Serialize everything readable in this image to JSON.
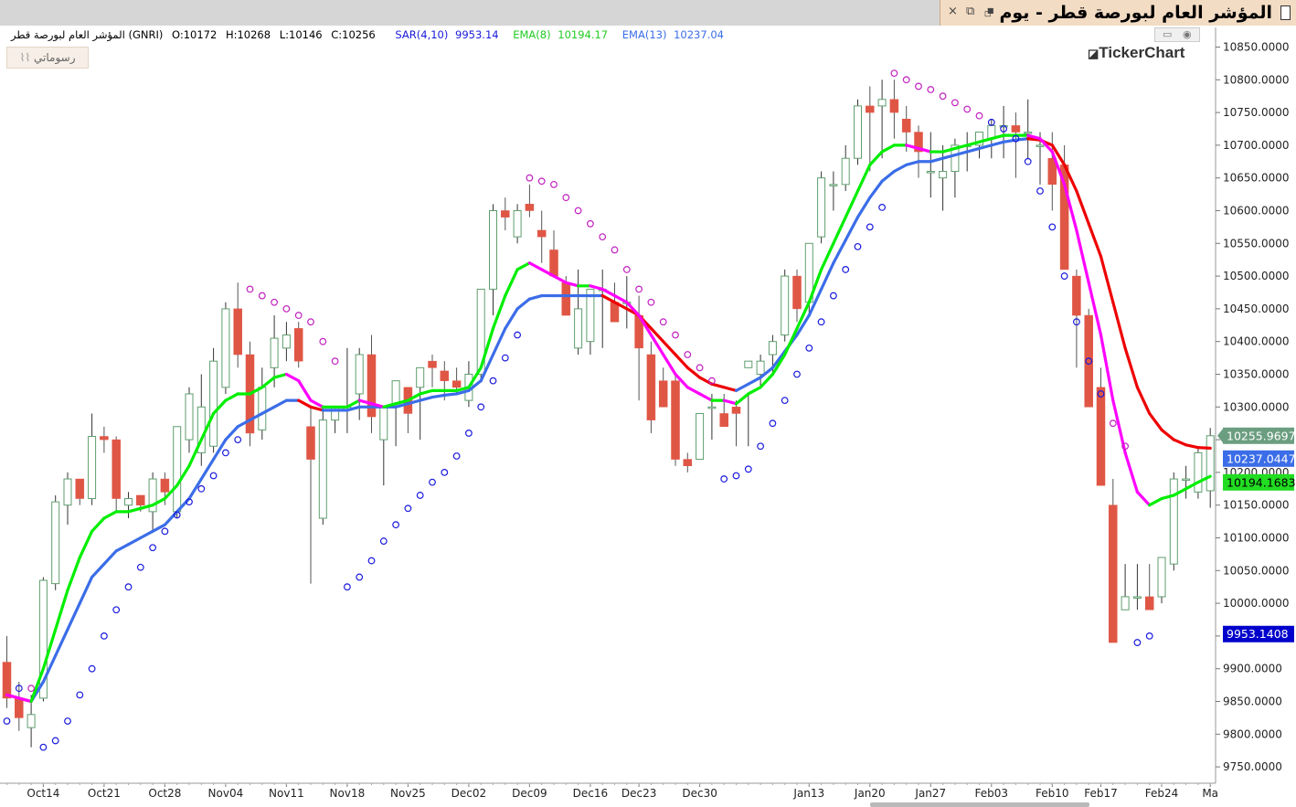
{
  "window": {
    "title": "المؤشر العام لبورصة قطر - يوم",
    "buttons": [
      "×",
      "⧉",
      "⮻"
    ]
  },
  "info_bar": {
    "name": "المؤشر العام لبورصة قطر (GNRI)",
    "open": "O:10172",
    "high": "H:10268",
    "low": "L:10146",
    "close": "C:10256",
    "sar_label": "SAR(4,10)",
    "sar_value": "9953.14",
    "ema8_label": "EMA(8)",
    "ema8_value": "10194.17",
    "ema13_label": "EMA(13)",
    "ema13_value": "10237.04"
  },
  "toolbar": {
    "drawing_label": "رسوماتي"
  },
  "brand": "TickerChart",
  "colors": {
    "up_candle": "#5f9e6e",
    "down_candle": "#e05645",
    "ema8": "#00ee00",
    "ema13": "#3b6de8",
    "ema_down": "#ee0000",
    "ema_cross": "#ff00ff",
    "sar_above": "#c020c0",
    "sar_below": "#1a1adc",
    "grid": "#e8e8e8"
  },
  "chart_data": {
    "type": "candlestick",
    "y_range": [
      9725,
      10880
    ],
    "y_ticks": [
      "10850.0000",
      "10800.0000",
      "10750.0000",
      "10700.0000",
      "10650.0000",
      "10600.0000",
      "10550.0000",
      "10500.0000",
      "10450.0000",
      "10400.0000",
      "10350.0000",
      "10300.0000",
      "10250.0000",
      "10200.0000",
      "10150.0000",
      "10100.0000",
      "10050.0000",
      "10000.0000",
      "9950.0000",
      "9900.0000",
      "9850.0000",
      "9800.0000",
      "9750.0000"
    ],
    "x_ticks": [
      {
        "label": "Oct14",
        "i": 3
      },
      {
        "label": "Oct21",
        "i": 8
      },
      {
        "label": "Oct28",
        "i": 13
      },
      {
        "label": "Nov04",
        "i": 18
      },
      {
        "label": "Nov11",
        "i": 23
      },
      {
        "label": "Nov18",
        "i": 28
      },
      {
        "label": "Nov25",
        "i": 33
      },
      {
        "label": "Dec02",
        "i": 38
      },
      {
        "label": "Dec09",
        "i": 43
      },
      {
        "label": "Dec16",
        "i": 48
      },
      {
        "label": "Dec23",
        "i": 52
      },
      {
        "label": "Dec30",
        "i": 57
      },
      {
        "label": "Jan13",
        "i": 66
      },
      {
        "label": "Jan20",
        "i": 71
      },
      {
        "label": "Jan27",
        "i": 76
      },
      {
        "label": "Feb03",
        "i": 81
      },
      {
        "label": "Feb10",
        "i": 86
      },
      {
        "label": "Feb17",
        "i": 90
      },
      {
        "label": "Feb24",
        "i": 95
      },
      {
        "label": "Ma",
        "i": 99
      }
    ],
    "candles": [
      [
        9910,
        9950,
        9840,
        9855
      ],
      [
        9855,
        9880,
        9805,
        9825
      ],
      [
        9810,
        9860,
        9780,
        9830
      ],
      [
        9855,
        10040,
        9850,
        10035
      ],
      [
        10030,
        10165,
        10020,
        10155
      ],
      [
        10150,
        10200,
        10120,
        10190
      ],
      [
        10190,
        10175,
        10150,
        10160
      ],
      [
        10160,
        10290,
        10150,
        10255
      ],
      [
        10255,
        10270,
        10230,
        10250
      ],
      [
        10250,
        10255,
        10140,
        10160
      ],
      [
        10150,
        10170,
        10130,
        10160
      ],
      [
        10165,
        10165,
        10140,
        10150
      ],
      [
        10140,
        10200,
        10110,
        10190
      ],
      [
        10190,
        10200,
        10150,
        10170
      ],
      [
        10140,
        10270,
        10130,
        10270
      ],
      [
        10250,
        10330,
        10230,
        10320
      ],
      [
        10230,
        10350,
        10210,
        10300
      ],
      [
        10240,
        10390,
        10230,
        10370
      ],
      [
        10330,
        10460,
        10320,
        10450
      ],
      [
        10450,
        10490,
        10360,
        10380
      ],
      [
        10380,
        10400,
        10240,
        10260
      ],
      [
        10265,
        10360,
        10250,
        10330
      ],
      [
        10360,
        10440,
        10330,
        10405
      ],
      [
        10390,
        10430,
        10370,
        10410
      ],
      [
        10420,
        10430,
        10360,
        10370
      ],
      [
        10270,
        10300,
        10030,
        10220
      ],
      [
        10130,
        10300,
        10120,
        10280
      ],
      [
        10280,
        10300,
        10260,
        10300
      ],
      [
        10295,
        10390,
        10260,
        10300
      ],
      [
        10320,
        10390,
        10280,
        10380
      ],
      [
        10380,
        10410,
        10260,
        10285
      ],
      [
        10250,
        10290,
        10180,
        10300
      ],
      [
        10305,
        10330,
        10240,
        10340
      ],
      [
        10330,
        10330,
        10260,
        10290
      ],
      [
        10330,
        10350,
        10250,
        10360
      ],
      [
        10370,
        10380,
        10330,
        10360
      ],
      [
        10355,
        10370,
        10310,
        10340
      ],
      [
        10340,
        10360,
        10320,
        10330
      ],
      [
        10310,
        10370,
        10300,
        10350
      ],
      [
        10350,
        10470,
        10340,
        10480
      ],
      [
        10480,
        10610,
        10440,
        10600
      ],
      [
        10600,
        10620,
        10570,
        10590
      ],
      [
        10560,
        10610,
        10550,
        10600
      ],
      [
        10610,
        10640,
        10590,
        10600
      ],
      [
        10570,
        10600,
        10520,
        10560
      ],
      [
        10540,
        10570,
        10500,
        10500
      ],
      [
        10490,
        10500,
        10440,
        10440
      ],
      [
        10390,
        10510,
        10380,
        10450
      ],
      [
        10400,
        10480,
        10380,
        10480
      ],
      [
        10480,
        10510,
        10390,
        10480
      ],
      [
        10460,
        10490,
        10430,
        10430
      ],
      [
        10460,
        10500,
        10420,
        10460
      ],
      [
        10440,
        10470,
        10310,
        10390
      ],
      [
        10380,
        10400,
        10260,
        10280
      ],
      [
        10340,
        10360,
        10300,
        10300
      ],
      [
        10340,
        10350,
        10210,
        10220
      ],
      [
        10220,
        10230,
        10200,
        10210
      ],
      [
        10220,
        10290,
        10220,
        10290
      ],
      [
        10300,
        10320,
        10250,
        10300
      ],
      [
        10290,
        10320,
        10270,
        10270
      ],
      [
        10300,
        10310,
        10240,
        10290
      ],
      [
        10360,
        10320,
        10240,
        10370
      ],
      [
        10350,
        10380,
        10330,
        10370
      ],
      [
        10380,
        10410,
        10350,
        10400
      ],
      [
        10410,
        10510,
        10400,
        10500
      ],
      [
        10500,
        10510,
        10430,
        10450
      ],
      [
        10460,
        10550,
        10440,
        10550
      ],
      [
        10560,
        10660,
        10550,
        10650
      ],
      [
        10640,
        10660,
        10600,
        10640
      ],
      [
        10640,
        10700,
        10630,
        10680
      ],
      [
        10680,
        10770,
        10670,
        10760
      ],
      [
        10760,
        10790,
        10660,
        10750
      ],
      [
        10760,
        10800,
        10680,
        10770
      ],
      [
        10770,
        10800,
        10710,
        10750
      ],
      [
        10740,
        10760,
        10690,
        10720
      ],
      [
        10720,
        10730,
        10650,
        10690
      ],
      [
        10660,
        10720,
        10620,
        10660
      ],
      [
        10650,
        10700,
        10600,
        10660
      ],
      [
        10660,
        10710,
        10620,
        10700
      ],
      [
        10700,
        10720,
        10660,
        10700
      ],
      [
        10700,
        10720,
        10680,
        10720
      ],
      [
        10710,
        10740,
        10680,
        10730
      ],
      [
        10730,
        10760,
        10680,
        10730
      ],
      [
        10730,
        10750,
        10650,
        10720
      ],
      [
        10720,
        10770,
        10680,
        10720
      ],
      [
        10700,
        10720,
        10640,
        10700
      ],
      [
        10680,
        10720,
        10600,
        10640
      ],
      [
        10670,
        10700,
        10550,
        10510
      ],
      [
        10500,
        10510,
        10360,
        10440
      ],
      [
        10440,
        10450,
        10300,
        10300
      ],
      [
        10330,
        10360,
        10180,
        10180
      ],
      [
        10150,
        10190,
        9940,
        9940
      ],
      [
        9990,
        10060,
        9990,
        10010
      ],
      [
        10010,
        10060,
        9990,
        10010
      ],
      [
        10010,
        10060,
        9990,
        9990
      ],
      [
        10010,
        10070,
        10000,
        10070
      ],
      [
        10060,
        10200,
        10050,
        10190
      ],
      [
        10190,
        10210,
        10160,
        10190
      ],
      [
        10170,
        10240,
        10160,
        10230
      ],
      [
        10172,
        10268,
        10146,
        10256
      ]
    ],
    "ema8": [
      9860,
      9855,
      9850,
      9900,
      9960,
      10020,
      10070,
      10110,
      10130,
      10140,
      10140,
      10145,
      10150,
      10160,
      10180,
      10210,
      10250,
      10290,
      10310,
      10320,
      10320,
      10330,
      10345,
      10350,
      10340,
      10310,
      10300,
      10300,
      10300,
      10310,
      10305,
      10300,
      10305,
      10310,
      10320,
      10325,
      10325,
      10325,
      10330,
      10360,
      10420,
      10470,
      10510,
      10520,
      10510,
      10500,
      10490,
      10485,
      10485,
      10480,
      10470,
      10460,
      10440,
      10410,
      10380,
      10350,
      10330,
      10320,
      10310,
      10310,
      10305,
      10320,
      10330,
      10350,
      10380,
      10420,
      10460,
      10510,
      10550,
      10590,
      10630,
      10670,
      10690,
      10700,
      10700,
      10695,
      10690,
      10690,
      10695,
      10700,
      10705,
      10710,
      10715,
      10715,
      10715,
      10710,
      10690,
      10640,
      10570,
      10490,
      10410,
      10310,
      10230,
      10170,
      10150,
      10160,
      10165,
      10175,
      10185,
      10194
    ],
    "ema13": [
      9860,
      9855,
      9850,
      9880,
      9920,
      9960,
      10000,
      10040,
      10060,
      10080,
      10090,
      10100,
      10110,
      10120,
      10140,
      10160,
      10190,
      10220,
      10250,
      10270,
      10280,
      10290,
      10300,
      10310,
      10310,
      10300,
      10295,
      10295,
      10295,
      10300,
      10300,
      10300,
      10300,
      10305,
      10310,
      10315,
      10318,
      10320,
      10325,
      10340,
      10380,
      10420,
      10450,
      10465,
      10470,
      10470,
      10470,
      10470,
      10470,
      10470,
      10460,
      10450,
      10440,
      10420,
      10400,
      10380,
      10360,
      10345,
      10335,
      10330,
      10325,
      10335,
      10345,
      10360,
      10385,
      10410,
      10440,
      10480,
      10520,
      10555,
      10590,
      10620,
      10645,
      10660,
      10670,
      10675,
      10675,
      10680,
      10685,
      10690,
      10695,
      10700,
      10705,
      10708,
      10710,
      10708,
      10700,
      10670,
      10630,
      10580,
      10530,
      10460,
      10390,
      10330,
      10290,
      10265,
      10250,
      10242,
      10238,
      10237
    ],
    "sar": [
      {
        "i": 0,
        "v": 9820
      },
      {
        "i": 1,
        "v": 9870
      },
      {
        "i": 2,
        "v": 9870
      },
      {
        "i": 3,
        "v": 9780
      },
      {
        "i": 4,
        "v": 9790
      },
      {
        "i": 5,
        "v": 9820
      },
      {
        "i": 6,
        "v": 9860
      },
      {
        "i": 7,
        "v": 9900
      },
      {
        "i": 8,
        "v": 9950
      },
      {
        "i": 9,
        "v": 9990
      },
      {
        "i": 10,
        "v": 10025
      },
      {
        "i": 11,
        "v": 10055
      },
      {
        "i": 12,
        "v": 10085
      },
      {
        "i": 13,
        "v": 10110
      },
      {
        "i": 14,
        "v": 10135
      },
      {
        "i": 15,
        "v": 10155
      },
      {
        "i": 16,
        "v": 10175
      },
      {
        "i": 17,
        "v": 10195
      },
      {
        "i": 18,
        "v": 10230
      },
      {
        "i": 19,
        "v": 10250
      },
      {
        "i": 20,
        "v": 10480
      },
      {
        "i": 21,
        "v": 10470
      },
      {
        "i": 22,
        "v": 10460
      },
      {
        "i": 23,
        "v": 10450
      },
      {
        "i": 24,
        "v": 10440
      },
      {
        "i": 25,
        "v": 10430
      },
      {
        "i": 26,
        "v": 10400
      },
      {
        "i": 27,
        "v": 10370
      },
      {
        "i": 28,
        "v": 10025
      },
      {
        "i": 29,
        "v": 10040
      },
      {
        "i": 30,
        "v": 10065
      },
      {
        "i": 31,
        "v": 10095
      },
      {
        "i": 32,
        "v": 10120
      },
      {
        "i": 33,
        "v": 10145
      },
      {
        "i": 34,
        "v": 10165
      },
      {
        "i": 35,
        "v": 10185
      },
      {
        "i": 36,
        "v": 10200
      },
      {
        "i": 37,
        "v": 10225
      },
      {
        "i": 38,
        "v": 10260
      },
      {
        "i": 39,
        "v": 10300
      },
      {
        "i": 40,
        "v": 10340
      },
      {
        "i": 41,
        "v": 10375
      },
      {
        "i": 42,
        "v": 10410
      },
      {
        "i": 43,
        "v": 10650
      },
      {
        "i": 44,
        "v": 10645
      },
      {
        "i": 45,
        "v": 10640
      },
      {
        "i": 46,
        "v": 10620
      },
      {
        "i": 47,
        "v": 10600
      },
      {
        "i": 48,
        "v": 10580
      },
      {
        "i": 49,
        "v": 10560
      },
      {
        "i": 50,
        "v": 10540
      },
      {
        "i": 51,
        "v": 10510
      },
      {
        "i": 52,
        "v": 10480
      },
      {
        "i": 53,
        "v": 10460
      },
      {
        "i": 54,
        "v": 10430
      },
      {
        "i": 55,
        "v": 10410
      },
      {
        "i": 56,
        "v": 10380
      },
      {
        "i": 57,
        "v": 10360
      },
      {
        "i": 58,
        "v": 10340
      },
      {
        "i": 59,
        "v": 10190
      },
      {
        "i": 60,
        "v": 10195
      },
      {
        "i": 61,
        "v": 10205
      },
      {
        "i": 62,
        "v": 10240
      },
      {
        "i": 63,
        "v": 10275
      },
      {
        "i": 64,
        "v": 10310
      },
      {
        "i": 65,
        "v": 10350
      },
      {
        "i": 66,
        "v": 10390
      },
      {
        "i": 67,
        "v": 10430
      },
      {
        "i": 68,
        "v": 10470
      },
      {
        "i": 69,
        "v": 10510
      },
      {
        "i": 70,
        "v": 10545
      },
      {
        "i": 71,
        "v": 10575
      },
      {
        "i": 72,
        "v": 10605
      },
      {
        "i": 73,
        "v": 10810
      },
      {
        "i": 74,
        "v": 10800
      },
      {
        "i": 75,
        "v": 10790
      },
      {
        "i": 76,
        "v": 10785
      },
      {
        "i": 77,
        "v": 10775
      },
      {
        "i": 78,
        "v": 10765
      },
      {
        "i": 79,
        "v": 10755
      },
      {
        "i": 80,
        "v": 10745
      },
      {
        "i": 81,
        "v": 10735
      },
      {
        "i": 82,
        "v": 10725
      },
      {
        "i": 83,
        "v": 10710
      },
      {
        "i": 84,
        "v": 10675
      },
      {
        "i": 85,
        "v": 10630
      },
      {
        "i": 86,
        "v": 10575
      },
      {
        "i": 87,
        "v": 10500
      },
      {
        "i": 88,
        "v": 10430
      },
      {
        "i": 89,
        "v": 10370
      },
      {
        "i": 90,
        "v": 10320
      },
      {
        "i": 91,
        "v": 10275
      },
      {
        "i": 92,
        "v": 10240
      },
      {
        "i": 93,
        "v": 9940
      },
      {
        "i": 94,
        "v": 9950
      }
    ],
    "price_labels": [
      {
        "text": "10255.9697",
        "v": 10256,
        "bg": "#6b9e80",
        "fg": "#ffffff",
        "arrow": true
      },
      {
        "text": "10237.0447",
        "v": 10237,
        "bg": "#3b6de8",
        "fg": "#ffffff",
        "arrow": false
      },
      {
        "text": "10194.1683",
        "v": 10194,
        "bg": "#22dd22",
        "fg": "#000000",
        "arrow": false
      },
      {
        "text": "9953.1408",
        "v": 9953,
        "bg": "#0000cc",
        "fg": "#ffffff",
        "arrow": false
      }
    ]
  }
}
